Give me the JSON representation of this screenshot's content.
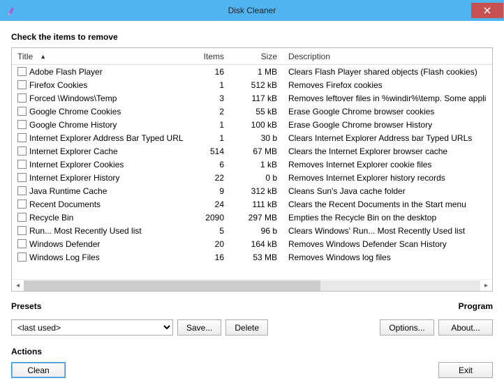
{
  "window": {
    "title": "Disk Cleaner"
  },
  "headings": {
    "check_items": "Check the items to remove",
    "presets": "Presets",
    "program": "Program",
    "actions": "Actions"
  },
  "columns": {
    "title": "Title",
    "items": "Items",
    "size": "Size",
    "description": "Description"
  },
  "rows": [
    {
      "title": "Adobe Flash Player",
      "items": "16",
      "size": "1 MB",
      "desc": "Clears Flash Player shared objects (Flash cookies)"
    },
    {
      "title": "Firefox Cookies",
      "items": "1",
      "size": "512 kB",
      "desc": "Removes Firefox cookies"
    },
    {
      "title": "Forced \\Windows\\Temp",
      "items": "3",
      "size": "117 kB",
      "desc": "Removes leftover files in %windir%\\temp. Some appli"
    },
    {
      "title": "Google Chrome Cookies",
      "items": "2",
      "size": "55 kB",
      "desc": "Erase Google Chrome browser cookies"
    },
    {
      "title": "Google Chrome History",
      "items": "1",
      "size": "100 kB",
      "desc": "Erase Google Chrome browser History"
    },
    {
      "title": "Internet Explorer Address Bar Typed URLs",
      "items": "1",
      "size": "30 b",
      "desc": "Clears Internet Explorer Address bar Typed URLs"
    },
    {
      "title": "Internet Explorer Cache",
      "items": "514",
      "size": "67 MB",
      "desc": "Clears the Internet Explorer browser cache"
    },
    {
      "title": "Internet Explorer Cookies",
      "items": "6",
      "size": "1 kB",
      "desc": "Removes Internet Explorer cookie files"
    },
    {
      "title": "Internet Explorer History",
      "items": "22",
      "size": "0 b",
      "desc": "Removes Internet Explorer history records"
    },
    {
      "title": "Java Runtime Cache",
      "items": "9",
      "size": "312 kB",
      "desc": "Cleans Sun's Java cache folder"
    },
    {
      "title": "Recent Documents",
      "items": "24",
      "size": "111 kB",
      "desc": "Clears the Recent Documents in the Start menu"
    },
    {
      "title": "Recycle Bin",
      "items": "2090",
      "size": "297 MB",
      "desc": "Empties the Recycle Bin on the desktop"
    },
    {
      "title": "Run... Most Recently Used list",
      "items": "5",
      "size": "96 b",
      "desc": "Clears Windows' Run... Most Recently Used list"
    },
    {
      "title": "Windows Defender",
      "items": "20",
      "size": "164 kB",
      "desc": "Removes Windows Defender Scan History"
    },
    {
      "title": "Windows Log Files",
      "items": "16",
      "size": "53 MB",
      "desc": "Removes Windows log files"
    }
  ],
  "preset": {
    "selected": "<last used>"
  },
  "buttons": {
    "save": "Save...",
    "delete": "Delete",
    "options": "Options...",
    "about": "About...",
    "clean": "Clean",
    "exit": "Exit"
  }
}
